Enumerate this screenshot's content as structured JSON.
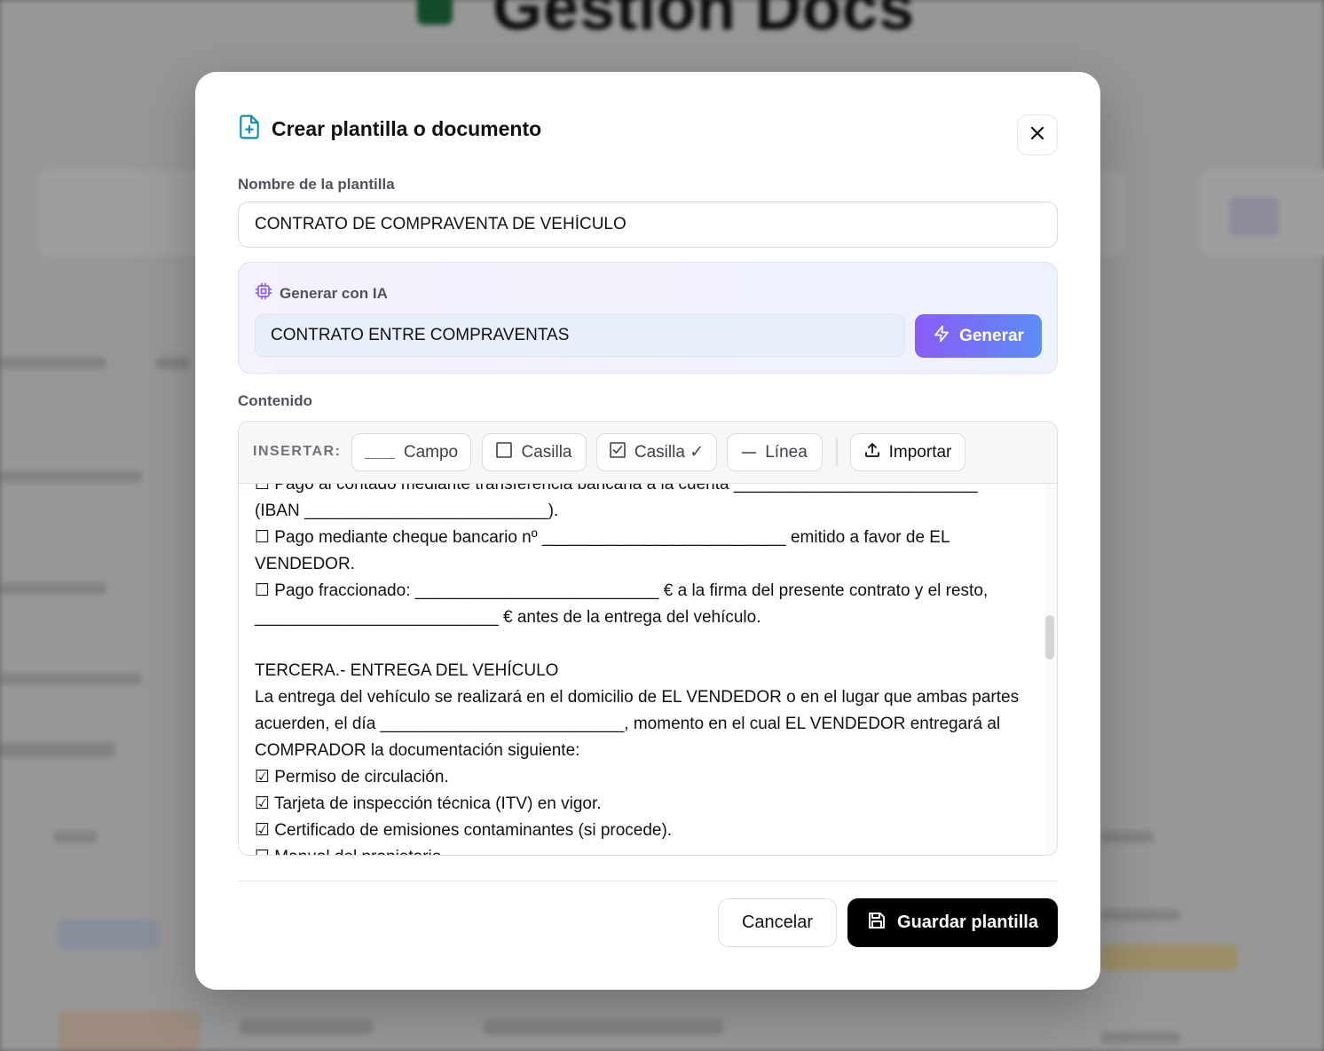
{
  "background": {
    "app_title": "Gestión Docs"
  },
  "modal": {
    "title": "Crear plantilla o documento",
    "name_label": "Nombre de la plantilla",
    "name_value": "CONTRATO DE COMPRAVENTA DE VEHÍCULO",
    "ai": {
      "label": "Generar con IA",
      "prompt_value": "CONTRATO ENTRE COMPRAVENTAS",
      "generate_label": "Generar"
    },
    "content_label": "Contenido",
    "toolbar": {
      "insert_label": "INSERTAR:",
      "field_label": "Campo",
      "checkbox_label": "Casilla",
      "checkbox_checked_label": "Casilla ✓",
      "line_label": "Línea",
      "import_label": "Importar"
    },
    "content_text": "☐ Pago al contado mediante transferencia bancaria a la cuenta __________________________\n(IBAN __________________________).\n☐ Pago mediante cheque bancario nº __________________________ emitido a favor de EL VENDEDOR.\n☐ Pago fraccionado: __________________________ € a la firma del presente contrato y el resto, __________________________ € antes de la entrega del vehículo.\n\nTERCERA.- ENTREGA DEL VEHÍCULO\nLa entrega del vehículo se realizará en el domicilio de EL VENDEDOR o en el lugar que ambas partes acuerden, el día __________________________, momento en el cual EL VENDEDOR entregará al COMPRADOR la documentación siguiente:\n☑ Permiso de circulación.\n☑ Tarjeta de inspección técnica (ITV) en vigor.\n☑ Certificado de emisiones contaminantes (si procede).\n☐ Manual del propietario.",
    "cancel_label": "Cancelar",
    "save_label": "Guardar plantilla"
  },
  "colors": {
    "accent_gradient_start": "#8b5cf6",
    "accent_gradient_end": "#5b8df6",
    "primary_button": "#000000",
    "icon_teal": "#0e8fa6"
  }
}
